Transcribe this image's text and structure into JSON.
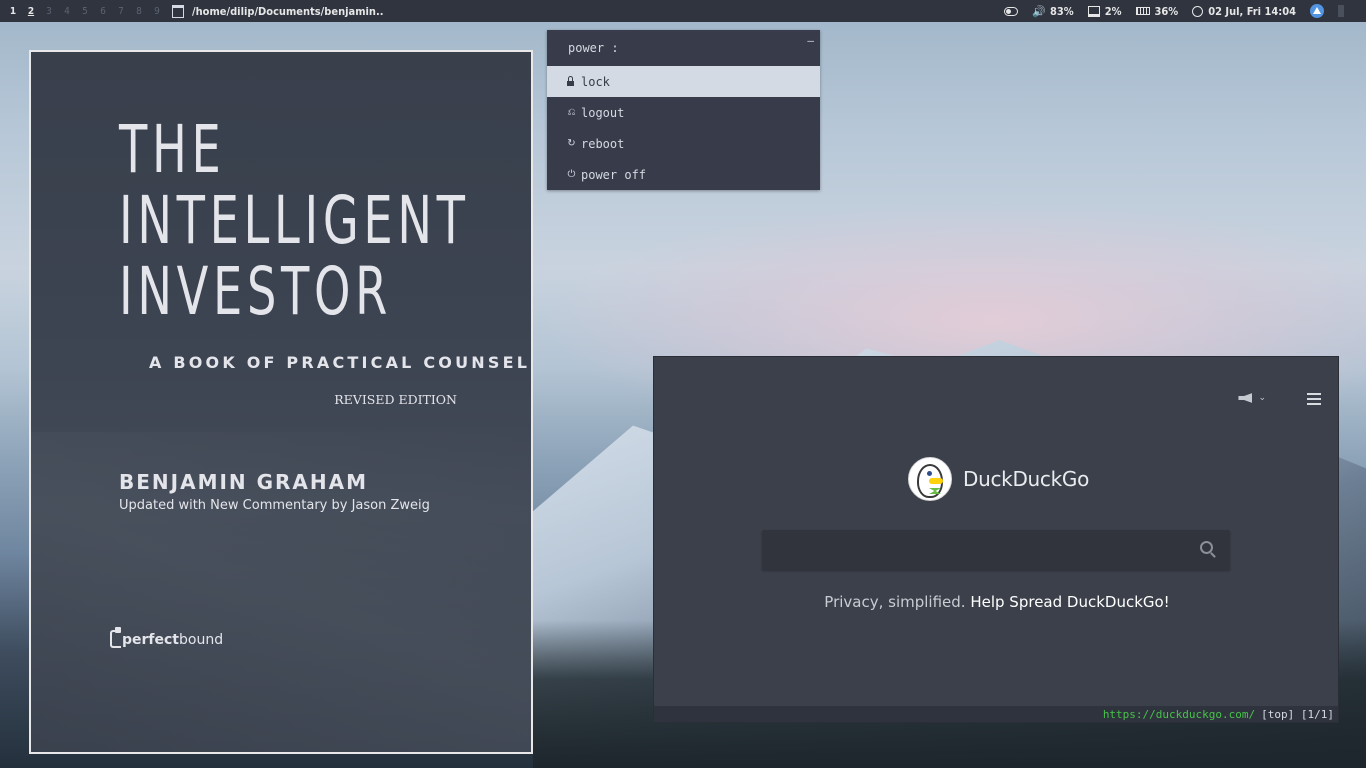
{
  "topbar": {
    "workspaces": [
      "1",
      "2",
      "3",
      "4",
      "5",
      "6",
      "7",
      "8",
      "9"
    ],
    "active_workspace": "2",
    "window_title": "/home/dilip/Documents/benjamin...",
    "indicators": {
      "volume": "83%",
      "cpu": "2%",
      "memory": "36%",
      "datetime": "02 Jul, Fri 14:04"
    },
    "icons": [
      "toggle-icon",
      "volume-icon",
      "monitor-icon",
      "ram-icon",
      "clock-icon",
      "tray-app-icon"
    ]
  },
  "book": {
    "title_lines": [
      "THE",
      "INTELLIGENT",
      "INVESTOR"
    ],
    "subtitle": "A BOOK OF PRACTICAL COUNSEL",
    "edition": "REVISED EDITION",
    "author": "BENJAMIN GRAHAM",
    "commentary": "Updated with New Commentary by Jason Zweig",
    "publisher_a": "perfect",
    "publisher_b": "bound"
  },
  "power_menu": {
    "prompt": "power :",
    "minimize": "–",
    "items": [
      {
        "label": "lock",
        "icon": "lock-icon",
        "selected": true
      },
      {
        "label": "logout",
        "icon": "logout-icon",
        "selected": false
      },
      {
        "label": "reboot",
        "icon": "reboot-icon",
        "selected": false
      },
      {
        "label": "power off",
        "icon": "power-icon",
        "selected": false
      }
    ]
  },
  "browser": {
    "brand": "DuckDuckGo",
    "search_placeholder": "",
    "tagline_plain": "Privacy, simplified.",
    "tagline_link": "Help Spread DuckDuckGo!",
    "status_url": "https://duckduckgo.com/",
    "status_position": "[top] [1/1]",
    "colors": {
      "url_green": "#46c349",
      "background": "#3c404b"
    }
  }
}
